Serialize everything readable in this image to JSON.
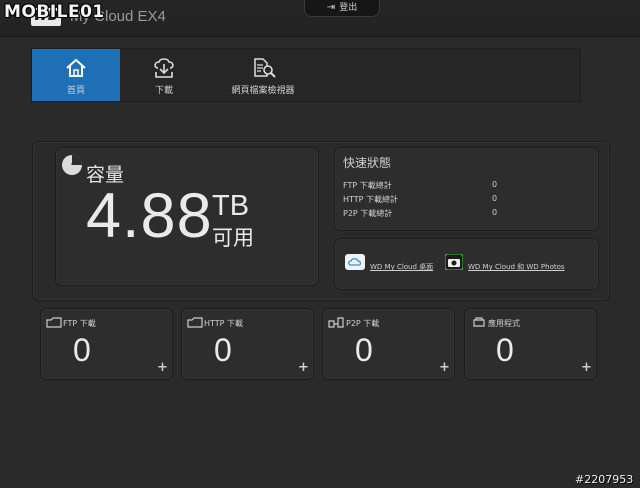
{
  "header": {
    "logo_text": "WD",
    "app_title": "My Cloud EX4",
    "logout_label": "登出",
    "watermark": "MOBILE01"
  },
  "nav": {
    "items": [
      {
        "label": "首頁",
        "icon": "home-icon",
        "active": true
      },
      {
        "label": "下載",
        "icon": "cloud-download-icon",
        "active": false
      },
      {
        "label": "網頁檔案檢視器",
        "icon": "file-search-icon",
        "active": false
      }
    ]
  },
  "capacity": {
    "title": "容量",
    "value": "4.88",
    "unit": "TB",
    "status": "可用"
  },
  "quick_status": {
    "title": "快速狀態",
    "rows": [
      {
        "label": "FTP 下載總計",
        "value": "0"
      },
      {
        "label": "HTTP 下載總計",
        "value": "0"
      },
      {
        "label": "P2P 下載總計",
        "value": "0"
      }
    ]
  },
  "apps_links": {
    "desktop_label": "WD My Cloud 桌面",
    "photos_label": "WD My Cloud 和 WD Photos"
  },
  "tiles": [
    {
      "label": "FTP 下載",
      "count": "0",
      "icon": "cloud-icon"
    },
    {
      "label": "HTTP 下載",
      "count": "0",
      "icon": "cloud-icon"
    },
    {
      "label": "P2P 下載",
      "count": "0",
      "icon": "p2p-icon"
    },
    {
      "label": "應用程式",
      "count": "0",
      "icon": "app-icon"
    }
  ],
  "footer": {
    "image_id": "#2207953"
  },
  "colors": {
    "accent": "#1f6fb6",
    "background": "#2a2a2a",
    "panel": "#2d2d2d"
  }
}
